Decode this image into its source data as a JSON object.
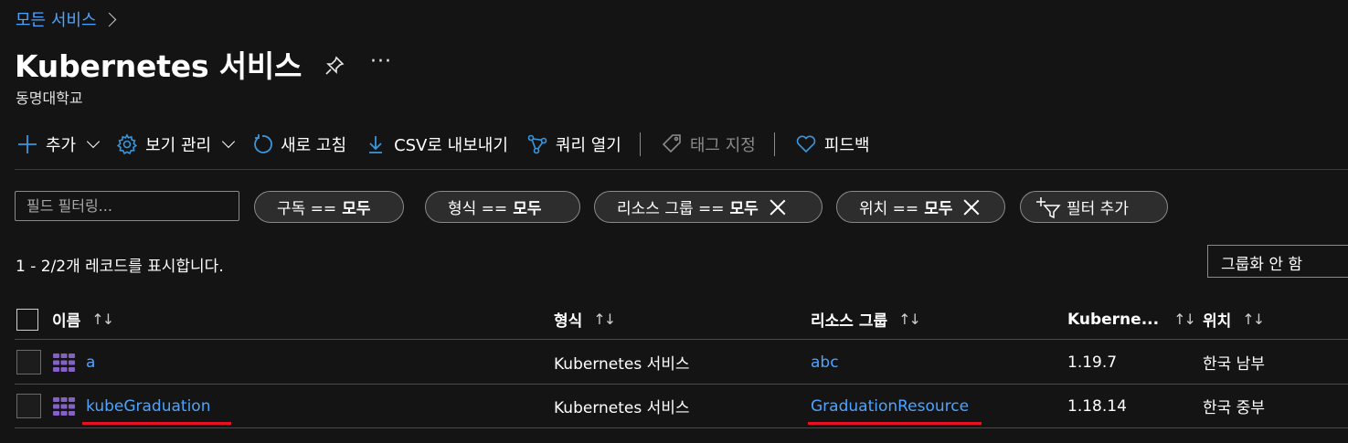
{
  "breadcrumb": {
    "label": "모든 서비스"
  },
  "page": {
    "title": "Kubernetes 서비스",
    "subtitle": "동명대학교",
    "more": "···"
  },
  "toolbar": {
    "add": "추가",
    "manage_view": "보기 관리",
    "refresh": "새로 고침",
    "export_csv": "CSV로 내보내기",
    "open_query": "쿼리 열기",
    "assign_tags": "태그 지정",
    "feedback": "피드백"
  },
  "filters": {
    "placeholder": "필드 필터링...",
    "subscription": {
      "label": "구독 ==",
      "value": "모두"
    },
    "type": {
      "label": "형식 ==",
      "value": "모두"
    },
    "resource_group": {
      "label": "리소스 그룹 ==",
      "value": "모두"
    },
    "location": {
      "label": "위치 ==",
      "value": "모두"
    },
    "add_filter": "필터 추가"
  },
  "records_text": "1 - 2/2개 레코드를 표시합니다.",
  "grouping": {
    "selected": "그룹화 안 함"
  },
  "table": {
    "columns": {
      "name": "이름",
      "type": "형식",
      "resource_group": "리소스 그룹",
      "kubernetes": "Kuberne...",
      "location": "위치",
      "sort": "↑↓"
    },
    "rows": [
      {
        "name": "a",
        "type": "Kubernetes 서비스",
        "resource_group": "abc",
        "version": "1.19.7",
        "location": "한국 남부"
      },
      {
        "name": "kubeGraduation",
        "type": "Kubernetes 서비스",
        "resource_group": "GraduationResource",
        "version": "1.18.14",
        "location": "한국 중부"
      }
    ]
  },
  "colors": {
    "link": "#4da3ff",
    "accent": "#3a96dd",
    "icon_purple": "#8661c5",
    "annotation_red": "#e81123"
  }
}
